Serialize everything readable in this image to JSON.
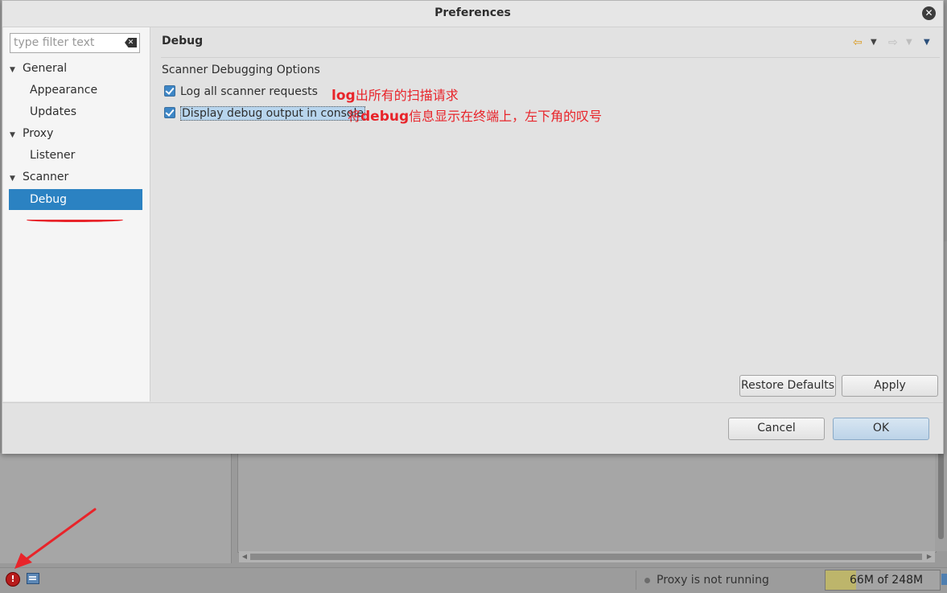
{
  "dialog": {
    "title": "Preferences",
    "filter_placeholder": "type filter text"
  },
  "nav": {
    "items": [
      {
        "label": "General",
        "level": 0,
        "expanded": true
      },
      {
        "label": "Appearance",
        "level": 1
      },
      {
        "label": "Updates",
        "level": 1
      },
      {
        "label": "Proxy",
        "level": 0,
        "expanded": true
      },
      {
        "label": "Listener",
        "level": 1
      },
      {
        "label": "Scanner",
        "level": 0,
        "expanded": true
      },
      {
        "label": "Debug",
        "level": 1,
        "selected": true
      }
    ],
    "expand_glyph": "▼"
  },
  "page": {
    "title": "Debug",
    "group_label": "Scanner Debugging Options",
    "options": [
      {
        "label": "Log all scanner requests",
        "checked": true
      },
      {
        "label": "Display debug output in console",
        "checked": true,
        "focused": true
      }
    ],
    "restore_defaults_label": "Restore Defaults",
    "apply_label": "Apply"
  },
  "annotations": {
    "note1_latin": "log",
    "note1_rest": "出所有的扫描请求",
    "note2_prefix": "将",
    "note2_latin": "debug",
    "note2_rest": "信息显示在终端上，左下角的叹号"
  },
  "buttons": {
    "cancel": "Cancel",
    "ok": "OK"
  },
  "statusbar": {
    "proxy_status": "Proxy is not running",
    "memory": "66M of 248M",
    "memory_used_fraction": 0.27
  },
  "colors": {
    "selection": "#2b82c2",
    "annotation": "#e8242a",
    "error_icon": "#b71c1c"
  },
  "icons": {
    "close": "close-icon",
    "clear_filter": "clear-filter-icon",
    "back": "back-arrow-icon",
    "forward": "forward-arrow-icon",
    "menu": "view-menu-icon",
    "error": "error-icon",
    "console": "console-icon"
  }
}
